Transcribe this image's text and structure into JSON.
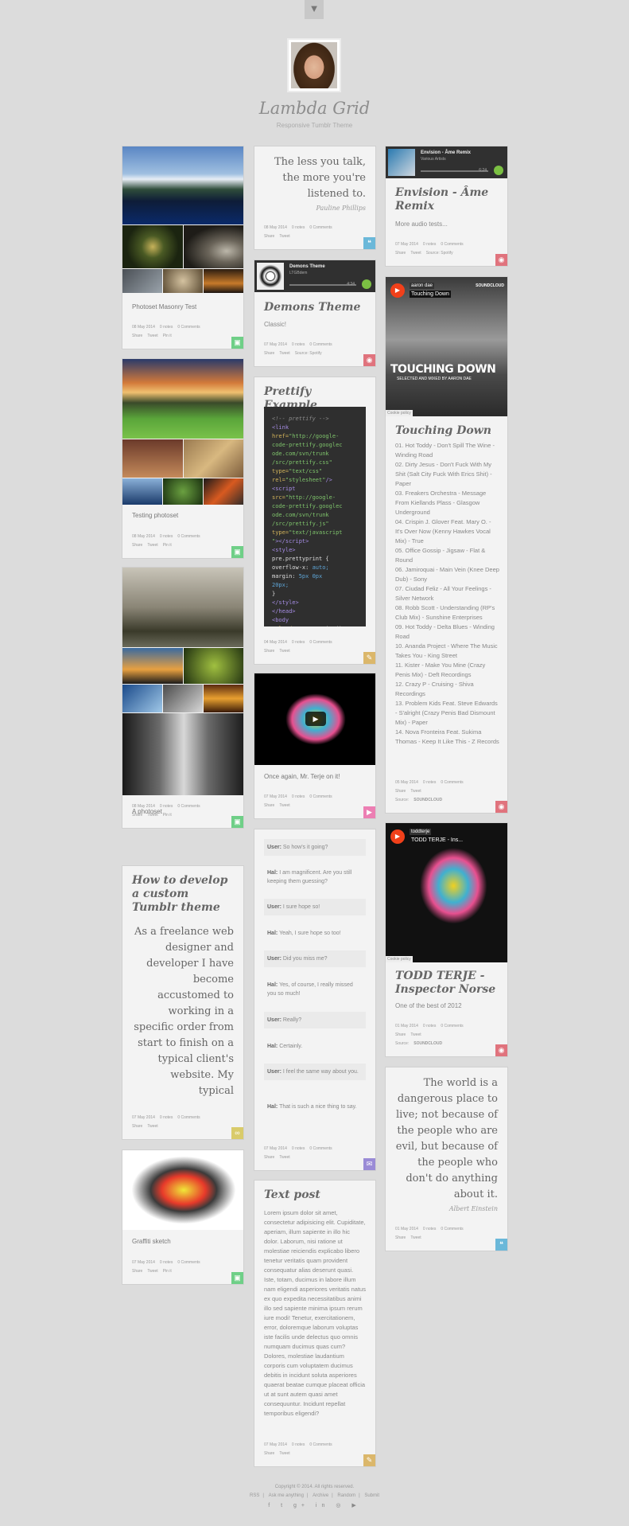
{
  "header": {
    "toggle_icon": "chevron-down-icon",
    "title": "Lambda Grid",
    "subtitle": "Responsive Tumblr Theme"
  },
  "posts": {
    "photoset1": {
      "caption": "Photoset Masonry Test",
      "date": "08 May 2014",
      "notes": "0 notes",
      "comments": "0 Comments",
      "share": "Share",
      "tweet": "Tweet",
      "pin": "Pin it"
    },
    "photoset2": {
      "caption": "Testing photoset",
      "date": "08 May 2014",
      "notes": "0 notes",
      "comments": "0 Comments",
      "share": "Share",
      "tweet": "Tweet",
      "pin": "Pin it"
    },
    "photoset3": {
      "caption": "A photoset",
      "date": "08 May 2014",
      "notes": "0 notes",
      "comments": "0 Comments",
      "share": "Share",
      "tweet": "Tweet",
      "pin": "Pin it"
    },
    "tumblrtheme": {
      "title": "How to develop a custom Tumblr theme",
      "body": "As a freelance web designer and developer I have become accustomed to working in a specific order from start to finish on a typical client's website. My typical",
      "date": "07 May 2014",
      "notes": "0 notes",
      "comments": "0 Comments",
      "share": "Share",
      "tweet": "Tweet"
    },
    "graffiti": {
      "caption": "Graffiti sketch",
      "date": "07 May 2014",
      "notes": "0 notes",
      "comments": "0 Comments",
      "share": "Share",
      "tweet": "Tweet",
      "pin": "Pin it"
    },
    "quote1": {
      "text": "The less you talk, the more you're listened to.",
      "source": "Pauline Phillips",
      "date": "08 May 2014",
      "notes": "0 notes",
      "comments": "0 Comments",
      "share": "Share",
      "tweet": "Tweet"
    },
    "demons": {
      "player_title": "Demons Theme",
      "player_sub": "LTGBdem",
      "time": "4:34",
      "title": "Demons Theme",
      "body": "Classic!",
      "date": "07 May 2014",
      "notes": "0 notes",
      "comments": "0 Comments",
      "share": "Share",
      "tweet": "Tweet",
      "source": "Source: Spotify"
    },
    "prettify": {
      "title": "Prettify Example",
      "date": "04 May 2014",
      "notes": "0 notes",
      "comments": "0 Comments",
      "share": "Share",
      "tweet": "Tweet"
    },
    "video": {
      "caption": "Once again, Mr. Terje on it!",
      "date": "07 May 2014",
      "notes": "0 notes",
      "comments": "0 Comments",
      "share": "Share",
      "tweet": "Tweet"
    },
    "chat": {
      "lines": [
        {
          "who": "User:",
          "text": "So how's it going?"
        },
        {
          "who": "Hal:",
          "text": "I am magnificent. Are you still keeping them guessing?"
        },
        {
          "who": "User:",
          "text": "I sure hope so!"
        },
        {
          "who": "Hal:",
          "text": "Yeah, I sure hope so too!"
        },
        {
          "who": "User:",
          "text": "Did you miss me?"
        },
        {
          "who": "Hal:",
          "text": "Yes, of course, I really missed you so much!"
        },
        {
          "who": "User:",
          "text": "Really?"
        },
        {
          "who": "Hal:",
          "text": "Certainly."
        },
        {
          "who": "User:",
          "text": "I feel the same way about you."
        },
        {
          "who": "Hal:",
          "text": "That is such a nice thing to say."
        }
      ],
      "date": "07 May 2014",
      "notes": "0 notes",
      "comments": "0 Comments",
      "share": "Share",
      "tweet": "Tweet"
    },
    "textpost": {
      "title": "Text post",
      "body": "Lorem ipsum dolor sit amet, consectetur adipisicing elit. Cupiditate, aperiam, illum sapiente in illo hic dolor. Laborum, nisi ratione ut molestiae reiciendis explicabo libero tenetur veritatis quam provident consequatur alias deserunt quasi. Iste, totam, ducimus in labore illum nam eligendi asperiores veritatis natus ex quo expedita necessitatibus animi illo sed sapiente minima ipsum rerum iure modi! Tenetur, exercitationem, error, doloremque laborum voluptas iste facilis unde delectus quo omnis numquam ducimus quas cum? Dolores, molestiae laudantium corporis cum voluptatem ducimus debitis in incidunt soluta asperiores quaerat beatae cumque placeat officia ut at sunt autem quasi amet consequuntur. Incidunt repellat temporibus eligendi?",
      "date": "07 May 2014",
      "notes": "0 notes",
      "comments": "0 Comments",
      "share": "Share",
      "tweet": "Tweet"
    },
    "envision": {
      "player_title": "Envision - Âme Remix",
      "player_sub": "Various Artists",
      "time": "6:24",
      "title": "Envision - Âme Remix",
      "body": "More audio tests...",
      "date": "07 May 2014",
      "notes": "0 notes",
      "comments": "0 Comments",
      "share": "Share",
      "tweet": "Tweet",
      "source": "Source: Spotify"
    },
    "touching": {
      "sc_user": "aaron dae",
      "sc_track": "Touching Down",
      "sc_brand": "SOUNDCLOUD",
      "art_text": "TOUCHING DOWN",
      "art_sub": "SELECTED AND MIXED BY AARON DAE",
      "cookie": "Cookie policy",
      "title": "Touching Down",
      "tracks": "01. Hot Toddy - Don't Spill The Wine - Winding Road\n02. Dirty Jesus - Don't Fuck With My Shit (Salt City Fuck With Erics Shit) - Paper\n03. Freakers Orchestra - Message From Kiellands Plass - Glasgow Underground\n04. Crispin J. Glover Feat. Mary O. - It's Over Now (Kenny Hawkes Vocal Mix) - True\n05. Office Gossip - Jigsaw - Flat & Round\n06. Jamiroquai - Main Vein (Knee Deep Dub) - Sony\n07. Ciudad Feliz - All Your Feelings - Silver Network\n08. Robb Scott - Understanding (RP's Club Mix) - Sunshine Enterprises\n09. Hot Toddy - Delta Blues - Winding Road\n10. Ananda Project - Where The Music Takes You - King Street\n11. Kister - Make You Mine (Crazy Penis Mix) - Deft Recordings\n12. Crazy P - Cruising - Shiva Recordings\n13. Problem Kids Feat. Steve Edwards - S'alright (Crazy Penis Bad Dismount Mix) - Paper\n14. Nova Fronteira Feat. Sukima Thomas - Keep It Like This - Z Records",
      "date": "05 May 2014",
      "notes": "0 notes",
      "comments": "0 Comments",
      "share": "Share",
      "tweet": "Tweet",
      "source": "Source:",
      "source_brand": "SOUNDCLOUD"
    },
    "toddterje": {
      "sc_user": "toddterje",
      "sc_track": "TODD TERJE - Ins...",
      "cookie": "Cookie policy",
      "title": "TODD TERJE - Inspector Norse",
      "body": "One of the best of 2012",
      "date": "01 May 2014",
      "notes": "0 notes",
      "comments": "0 Comments",
      "share": "Share",
      "tweet": "Tweet",
      "source": "Source:",
      "source_brand": "SOUNDCLOUD"
    },
    "quote2": {
      "text": "The world is a dangerous place to live; not because of the people who are evil, but because of the people who don't do anything about it.",
      "source": "Albert Einstein",
      "date": "01 May 2014",
      "notes": "0 notes",
      "comments": "0 Comments",
      "share": "Share",
      "tweet": "Tweet"
    }
  },
  "footer": {
    "copyright": "Copyright © 2014. All rights reserved.",
    "links": [
      "RSS",
      "Ask me anything",
      "Archive",
      "Random",
      "Submit"
    ],
    "social": "f  t  g+  in  ◎  ▶"
  },
  "colors": {
    "background": "#dcdcdc",
    "photo": "#6fcf87",
    "quote": "#6bb8d9",
    "audio": "#e0737d",
    "text": "#dbb76b",
    "video": "#ec7fb3",
    "chat": "#9a8bd6",
    "link": "#d9cb6a"
  }
}
